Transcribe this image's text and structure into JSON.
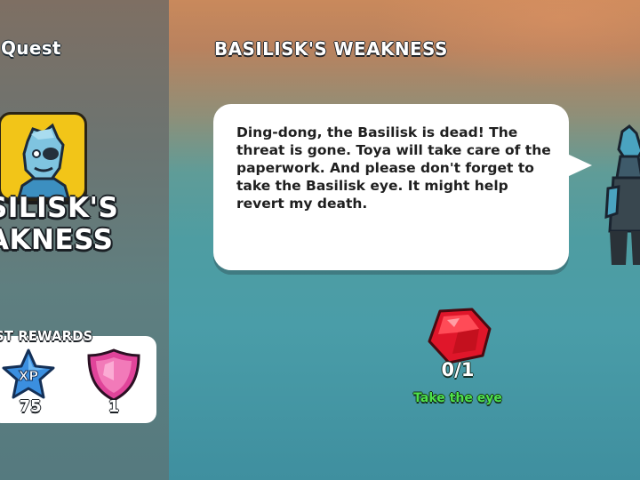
{
  "sidebar": {
    "header_label": "Quest",
    "quest_title_line1": "SILISK'S",
    "quest_title_line2": "AKNESS",
    "rewards_label": "ST REWARDS",
    "rewards": [
      {
        "icon": "xp-star-icon",
        "label": "XP",
        "value": "75"
      },
      {
        "icon": "pink-shield-gem-icon",
        "value": "1"
      }
    ]
  },
  "main": {
    "title": "BASILISK'S WEAKNESS",
    "dialogue": "Ding-dong, the Basilisk is dead! The threat is gone. Toya will take care of the paperwork. And please don't forget to take the Basilisk eye. It might help revert my death.",
    "objective": {
      "icon": "red-gem-icon",
      "progress": "0/1",
      "caption": "Take the eye"
    }
  },
  "colors": {
    "sidebar": "#6c7471",
    "sky_top": "#c9895c",
    "ground": "#4a9da8",
    "portrait_bg": "#f2c518",
    "objective_green": "#4ee24a"
  }
}
